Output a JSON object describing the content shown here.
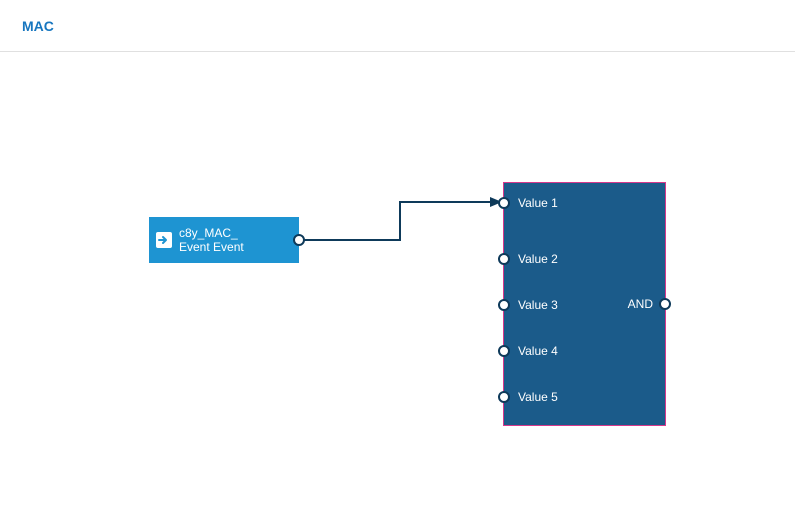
{
  "header": {
    "tab": "MAC"
  },
  "event_node": {
    "label_line1": "c8y_MAC_",
    "label_line2": "Event Event"
  },
  "and_node": {
    "output_label": "AND",
    "inputs": [
      "Value 1",
      "Value 2",
      "Value 3",
      "Value 4",
      "Value 5"
    ]
  },
  "colors": {
    "event_bg": "#1E94D2",
    "and_bg": "#1B5B8A",
    "and_border": "#D6388B",
    "connector": "#0E3A5A",
    "tab": "#1776BF"
  }
}
